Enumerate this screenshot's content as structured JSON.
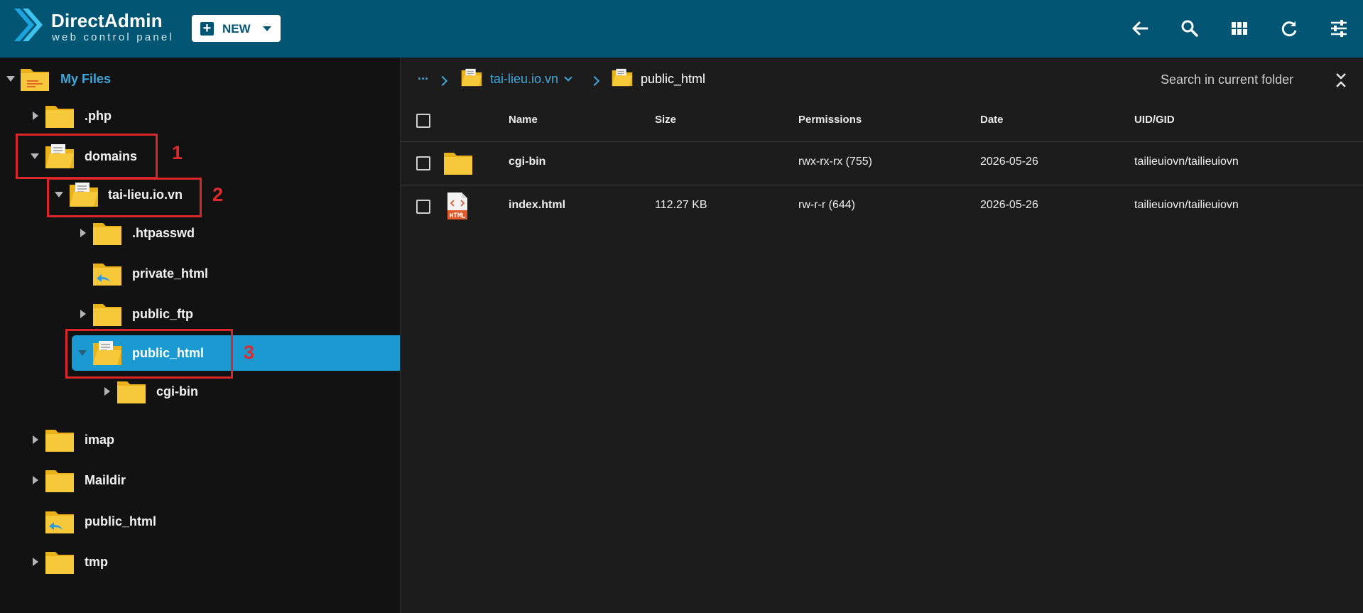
{
  "header": {
    "brand_title": "DirectAdmin",
    "brand_subtitle": "web control panel",
    "new_button_label": "NEW",
    "accent_color": "#035673",
    "icons": [
      "back-arrow-icon",
      "search-icon",
      "grid-view-icon",
      "refresh-icon",
      "settings-sliders-icon"
    ]
  },
  "tree": {
    "root_label": "My Files",
    "items": [
      {
        "label": ".php"
      },
      {
        "label": "domains"
      },
      {
        "label": "tai-lieu.io.vn"
      },
      {
        "label": ".htpasswd"
      },
      {
        "label": "private_html"
      },
      {
        "label": "public_ftp"
      },
      {
        "label": "public_html"
      },
      {
        "label": "cgi-bin"
      },
      {
        "label": "imap"
      },
      {
        "label": "Maildir"
      },
      {
        "label": "public_html"
      },
      {
        "label": "tmp"
      }
    ],
    "selected_color": "#1a9ad0"
  },
  "annotations": [
    "1",
    "2",
    "3"
  ],
  "breadcrumb": {
    "ellipsis": "...",
    "domain": "tai-lieu.io.vn",
    "current": "public_html"
  },
  "search": {
    "placeholder": "Search in current folder"
  },
  "table": {
    "columns": [
      "Name",
      "Size",
      "Permissions",
      "Date",
      "UID/GID"
    ],
    "rows": [
      {
        "name": "cgi-bin",
        "size": "",
        "permissions": "rwx-rx-rx (755)",
        "date": "2026-05-26",
        "uid_gid": "tailieuiovn/tailieuiovn",
        "type": "folder"
      },
      {
        "name": "index.html",
        "size": "112.27 KB",
        "permissions": "rw-r-r (644)",
        "date": "2026-05-26",
        "uid_gid": "tailieuiovn/tailieuiovn",
        "type": "html-file"
      }
    ]
  }
}
